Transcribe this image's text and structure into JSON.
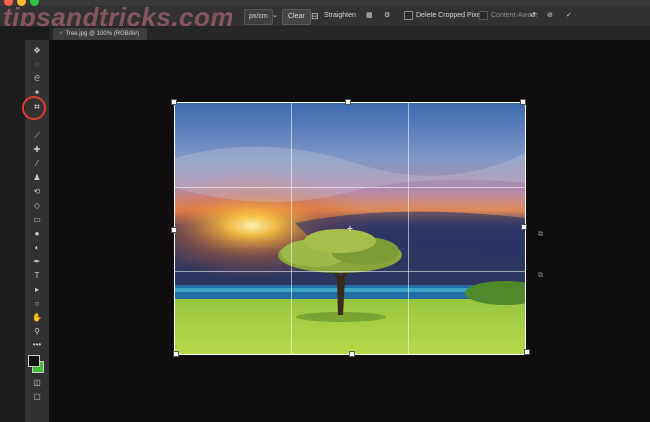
{
  "watermark": "tipsandtricks.com",
  "window": {
    "controls": [
      {
        "name": "close",
        "color": "#ff5f57"
      },
      {
        "name": "minimize",
        "color": "#febc2e"
      },
      {
        "name": "zoom",
        "color": "#28c840"
      }
    ]
  },
  "options_bar": {
    "units_select": "px/cm",
    "clear_label": "Clear",
    "straighten_label": "Straighten",
    "delete_cropped_label": "Delete Cropped Pixels",
    "content_aware_label": "Content-Aware",
    "icons": [
      "straighten-icon",
      "overlay-grid-icon",
      "settings-gear-icon",
      "reset-icon",
      "cancel-icon",
      "commit-checkmark-icon"
    ]
  },
  "document": {
    "tab_label": "Tree.jpg @ 100% (RGB/8#)"
  },
  "tools": [
    "move-icon",
    "marquee-icon",
    "lasso-icon",
    "magic-wand-icon",
    "crop-icon",
    "eyedropper-icon",
    "healing-brush-icon",
    "brush-icon",
    "clone-stamp-icon",
    "history-brush-icon",
    "eraser-icon",
    "gradient-icon",
    "blur-icon",
    "dodge-icon",
    "pen-icon",
    "type-icon",
    "path-selection-icon",
    "shape-icon",
    "hand-icon",
    "zoom-icon",
    "more-icon",
    "color-swatches-icon",
    "quick-mask-icon",
    "screen-mode-icon"
  ],
  "accent_colors": {
    "highlight_ring": "#e03a2d",
    "foreground_swatch": "#111111",
    "background_swatch": "#3fbf3a"
  }
}
